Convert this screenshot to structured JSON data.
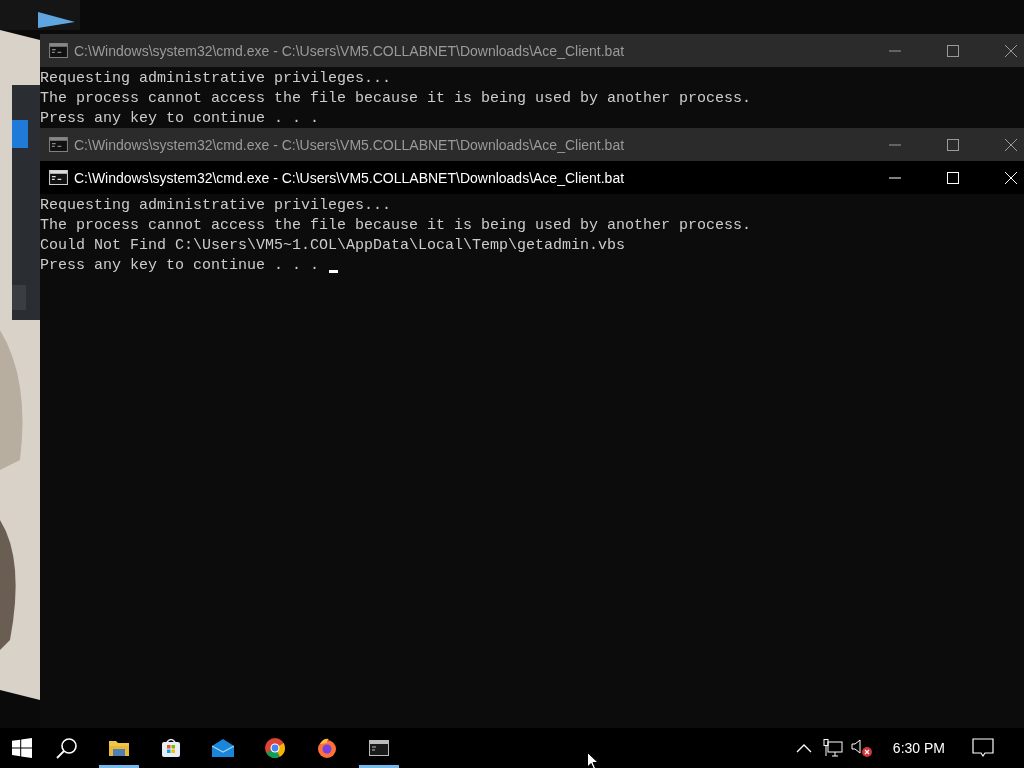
{
  "windows": [
    {
      "title": "C:\\Windows\\system32\\cmd.exe - C:\\Users\\VM5.COLLABNET\\Downloads\\Ace_Client.bat",
      "active": false,
      "lines": [
        "Requesting administrative privileges...",
        "The process cannot access the file because it is being used by another process.",
        "Press any key to continue . . ."
      ]
    },
    {
      "title": "C:\\Windows\\system32\\cmd.exe - C:\\Users\\VM5.COLLABNET\\Downloads\\Ace_Client.bat",
      "active": false
    },
    {
      "title": "C:\\Windows\\system32\\cmd.exe - C:\\Users\\VM5.COLLABNET\\Downloads\\Ace_Client.bat",
      "active": true,
      "lines": [
        "Requesting administrative privileges...",
        "The process cannot access the file because it is being used by another process.",
        "Could Not Find C:\\Users\\VM5~1.COL\\AppData\\Local\\Temp\\getadmin.vbs",
        "Press any key to continue . . ."
      ]
    }
  ],
  "taskbar": {
    "apps": [
      {
        "kind": "start",
        "running": false
      },
      {
        "kind": "search",
        "running": false
      },
      {
        "kind": "explorer",
        "running": true
      },
      {
        "kind": "store",
        "running": false
      },
      {
        "kind": "mail",
        "running": false
      },
      {
        "kind": "chrome",
        "running": false
      },
      {
        "kind": "firefox",
        "running": false
      },
      {
        "kind": "console",
        "running": true
      }
    ],
    "tray": {
      "volume_muted": true,
      "clock": "6:30 PM"
    }
  }
}
